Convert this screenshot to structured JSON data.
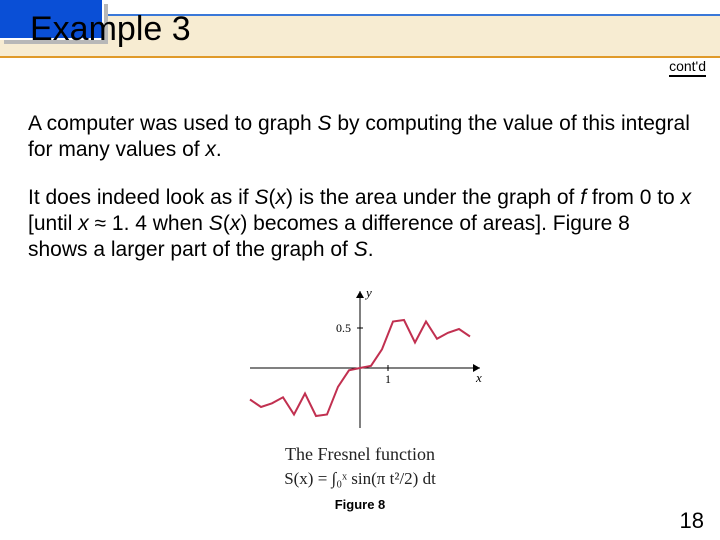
{
  "header": {
    "title": "Example 3",
    "contd": "cont'd"
  },
  "paragraphs": {
    "p1_a": "A computer was used to graph ",
    "p1_var1": "S",
    "p1_b": " by computing the value of this integral for many values of ",
    "p1_var2": "x",
    "p1_c": ".",
    "p2_a": "It does indeed look as if ",
    "p2_var1": "S",
    "p2_b": "(",
    "p2_var2": "x",
    "p2_c": ") is the area under the graph of ",
    "p2_var3": "f",
    "p2_d": " from 0 to ",
    "p2_var4": "x",
    "p2_e": " [until ",
    "p2_var5": "x",
    "p2_f": " ≈ 1. 4 when ",
    "p2_var6": "S",
    "p2_g": "(",
    "p2_var7": "x",
    "p2_h": ") becomes a difference of areas]. Figure 8 shows a larger part of the graph of ",
    "p2_var8": "S",
    "p2_i": "."
  },
  "figure": {
    "y_label": "y",
    "x_label": "x",
    "y_tick": "0.5",
    "x_tick": "1",
    "title": "The Fresnel function",
    "formula": "S(x) = ∫₀ˣ sin(π t²/2) dt",
    "label": "Figure 8"
  },
  "page_number": "18",
  "chart_data": {
    "type": "line",
    "title": "The Fresnel function",
    "xlabel": "x",
    "ylabel": "y",
    "xlim": [
      -4,
      4
    ],
    "ylim": [
      -0.8,
      0.8
    ],
    "y_ticks": [
      0.5
    ],
    "x_ticks": [
      1
    ],
    "series": [
      {
        "name": "S(x)",
        "x": [
          -4.0,
          -3.6,
          -3.2,
          -2.8,
          -2.4,
          -2.0,
          -1.6,
          -1.2,
          -0.8,
          -0.4,
          0.0,
          0.4,
          0.8,
          1.2,
          1.6,
          2.0,
          2.4,
          2.8,
          3.2,
          3.6,
          4.0
        ],
        "values": [
          -0.42,
          -0.52,
          -0.47,
          -0.39,
          -0.62,
          -0.34,
          -0.64,
          -0.62,
          -0.25,
          -0.03,
          0.0,
          0.03,
          0.25,
          0.62,
          0.64,
          0.34,
          0.62,
          0.39,
          0.47,
          0.52,
          0.42
        ]
      }
    ]
  }
}
